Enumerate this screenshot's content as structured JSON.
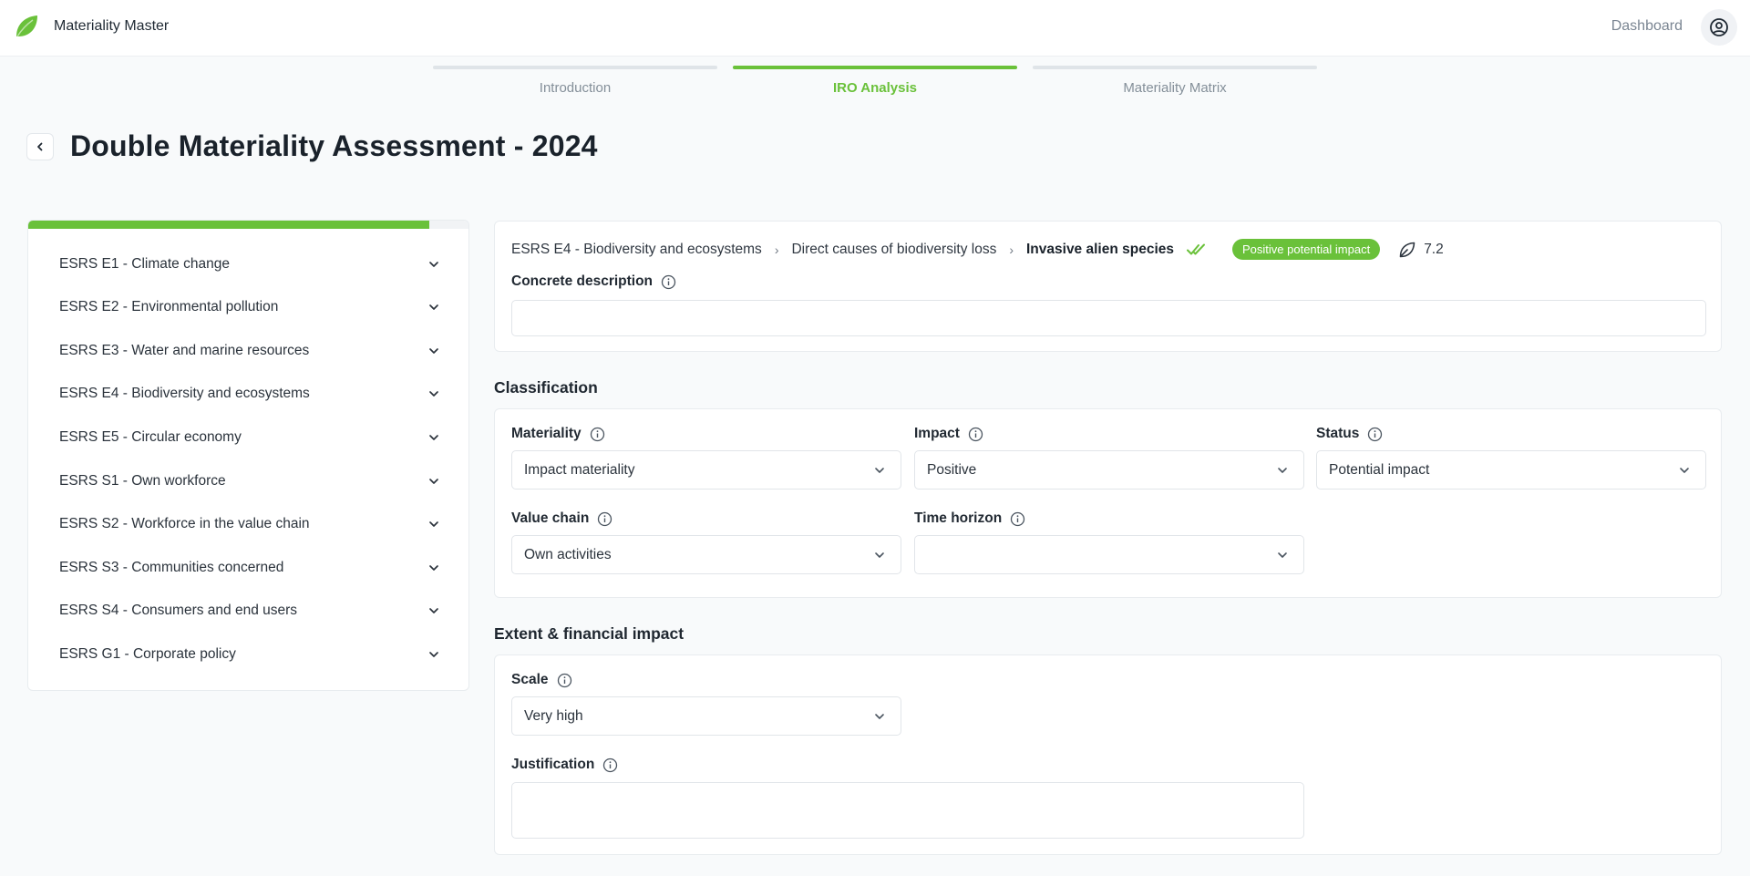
{
  "app": {
    "title": "Materiality Master",
    "dashboard_label": "Dashboard",
    "accent": "#6ac13a"
  },
  "stepper": [
    {
      "label": "Introduction",
      "active": false
    },
    {
      "label": "IRO Analysis",
      "active": true
    },
    {
      "label": "Materiality Matrix",
      "active": false
    }
  ],
  "page": {
    "title": "Double Materiality Assessment - 2024"
  },
  "sidebar": {
    "progress": 0.91,
    "items": [
      {
        "label": "ESRS E1 - Climate change"
      },
      {
        "label": "ESRS E2 - Environmental pollution"
      },
      {
        "label": "ESRS E3 - Water and marine resources"
      },
      {
        "label": "ESRS E4 - Biodiversity and ecosystems"
      },
      {
        "label": "ESRS E5 - Circular economy"
      },
      {
        "label": "ESRS S1 - Own workforce"
      },
      {
        "label": "ESRS S2 - Workforce in the value chain"
      },
      {
        "label": "ESRS S3 - Communities concerned"
      },
      {
        "label": "ESRS S4 - Consumers and end users"
      },
      {
        "label": "ESRS G1 - Corporate policy"
      }
    ]
  },
  "detail": {
    "breadcrumb": [
      "ESRS E4 - Biodiversity and ecosystems",
      "Direct causes of biodiversity loss",
      "Invasive alien species"
    ],
    "badge": "Positive potential impact",
    "score": "7.2",
    "concrete_description_label": "Concrete description",
    "concrete_description_value": ""
  },
  "classification": {
    "title": "Classification",
    "materiality": {
      "label": "Materiality",
      "value": "Impact materiality"
    },
    "impact": {
      "label": "Impact",
      "value": "Positive"
    },
    "status": {
      "label": "Status",
      "value": "Potential impact"
    },
    "value_chain": {
      "label": "Value chain",
      "value": "Own activities"
    },
    "time_horizon": {
      "label": "Time horizon",
      "value": ""
    }
  },
  "extent": {
    "title": "Extent & financial impact",
    "scale": {
      "label": "Scale",
      "value": "Very high"
    },
    "justification": {
      "label": "Justification",
      "value": ""
    }
  }
}
